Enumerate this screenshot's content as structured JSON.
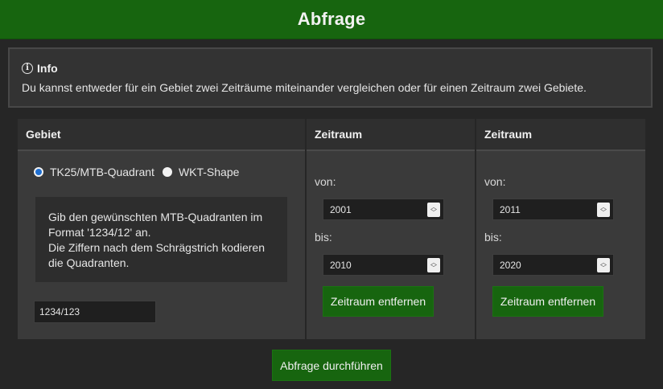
{
  "header": {
    "title": "Abfrage"
  },
  "info": {
    "title": "Info",
    "icon": "info-circle-icon",
    "text": "Du kannst entweder für ein Gebiet zwei Zeiträume miteinander vergleichen oder für einen Zeitraum zwei Gebiete."
  },
  "gebiet": {
    "heading": "Gebiet",
    "options": [
      {
        "label": "TK25/MTB-Quadrant",
        "checked": true
      },
      {
        "label": "WKT-Shape",
        "checked": false
      }
    ],
    "hint_lines": [
      "Gib den gewünschten MTB-Quadranten im",
      "Format '1234/12' an.",
      "Die Ziffern nach dem Schrägstrich kodieren",
      "die Quadranten."
    ],
    "input_value": "1234/123"
  },
  "zeitraeume": [
    {
      "heading": "Zeitraum",
      "von_label": "von:",
      "von_value": "2001",
      "bis_label": "bis:",
      "bis_value": "2010",
      "remove_label": "Zeitraum entfernen"
    },
    {
      "heading": "Zeitraum",
      "von_label": "von:",
      "von_value": "2011",
      "bis_label": "bis:",
      "bis_value": "2020",
      "remove_label": "Zeitraum entfernen"
    }
  ],
  "submit_label": "Abfrage durchführen",
  "colors": {
    "accent_green": "#17650f",
    "background": "#262626",
    "panel": "#3a3a3a"
  }
}
